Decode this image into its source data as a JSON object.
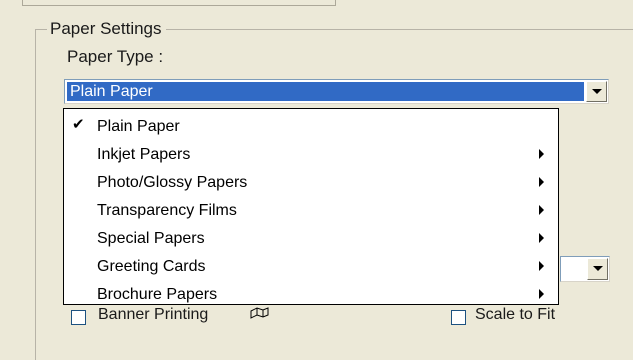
{
  "group_title": "Paper Settings",
  "paper_type_label": "Paper Type :",
  "selected_value": "Plain Paper",
  "menu": [
    {
      "label": "Plain Paper",
      "checked": true,
      "submenu": false
    },
    {
      "label": "Inkjet Papers",
      "checked": false,
      "submenu": true
    },
    {
      "label": "Photo/Glossy Papers",
      "checked": false,
      "submenu": true
    },
    {
      "label": "Transparency Films",
      "checked": false,
      "submenu": true
    },
    {
      "label": "Special Papers",
      "checked": false,
      "submenu": true
    },
    {
      "label": "Greeting Cards",
      "checked": false,
      "submenu": true
    },
    {
      "label": "Brochure Papers",
      "checked": false,
      "submenu": true
    }
  ],
  "bottom": {
    "banner_printing": "Banner Printing",
    "scale_to_fit": "Scale to Fit"
  },
  "icons": {
    "check": "checkmark-icon",
    "submenu": "submenu-arrow-icon",
    "dropdown": "dropdown-arrow-icon",
    "banner": "banner-icon"
  },
  "colors": {
    "selection": "#316ac5",
    "window": "#ece9d8"
  }
}
